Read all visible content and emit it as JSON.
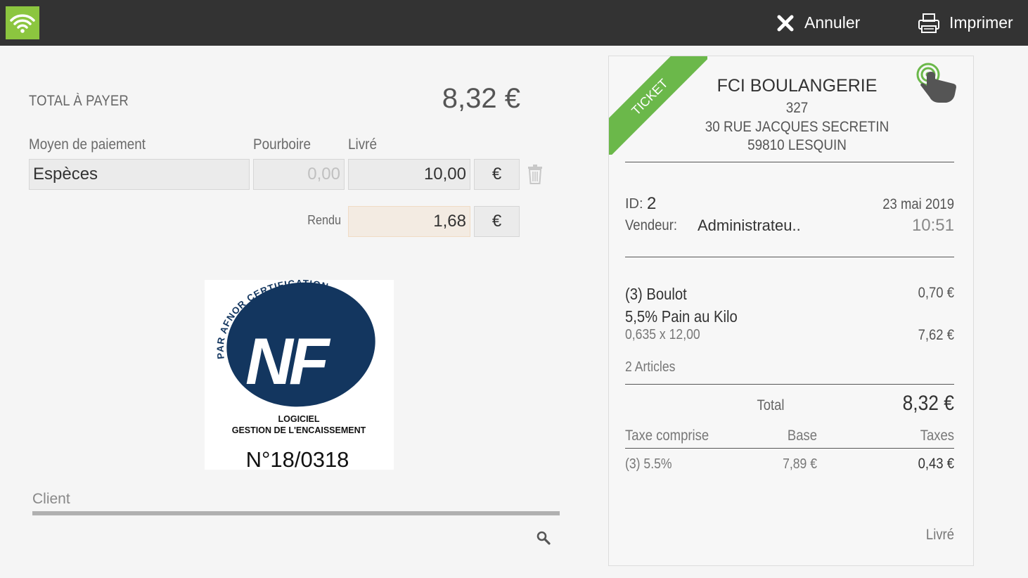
{
  "topbar": {
    "cancel_label": "Annuler",
    "print_label": "Imprimer"
  },
  "payment": {
    "total_label": "TOTAL À PAYER",
    "total_value": "8,32 €",
    "method_header": "Moyen de paiement",
    "tip_header": "Pourboire",
    "given_header": "Livré",
    "method_value": "Espèces",
    "tip_value": "0,00",
    "given_value": "10,00",
    "currency": "€",
    "change_label": "Rendu",
    "change_value": "1,68"
  },
  "certification": {
    "logo_text_top": "PAR AFNOR CERTIFICATION",
    "logo_mark": "NF",
    "logo_line1": "LOGICIEL",
    "logo_line2": "GESTION DE L'ENCAISSEMENT",
    "number": "N°18/0318"
  },
  "client": {
    "label": "Client"
  },
  "ticket": {
    "ribbon": "TICKET",
    "shop_name": "FCI BOULANGERIE",
    "address_line1": "327",
    "address_line2": "30 RUE JACQUES SECRETIN",
    "address_line3": "59810 LESQUIN",
    "id_label": "ID:",
    "id_value": "2",
    "date": "23 mai 2019",
    "seller_label": "Vendeur:",
    "seller_value": "Administrateu..",
    "time": "10:51",
    "items": [
      {
        "name": "(3) Boulot",
        "price": "0,70 €"
      },
      {
        "name": "5,5% Pain au Kilo",
        "detail": "0,635 x 12,00",
        "price": "7,62 €"
      }
    ],
    "article_count": "2 Articles",
    "total_label": "Total",
    "total_value": "8,32 €",
    "tax_header": "Taxe comprise",
    "base_header": "Base",
    "taxes_header": "Taxes",
    "tax_rate": "(3) 5.5%",
    "tax_base": "7,89 €",
    "tax_amount": "0,43 €",
    "given_label": "Livré"
  },
  "colors": {
    "topbar": "#333333",
    "accent_green": "#8cc63f",
    "ribbon_green": "#6bb84a",
    "nf_blue": "#13365f"
  }
}
